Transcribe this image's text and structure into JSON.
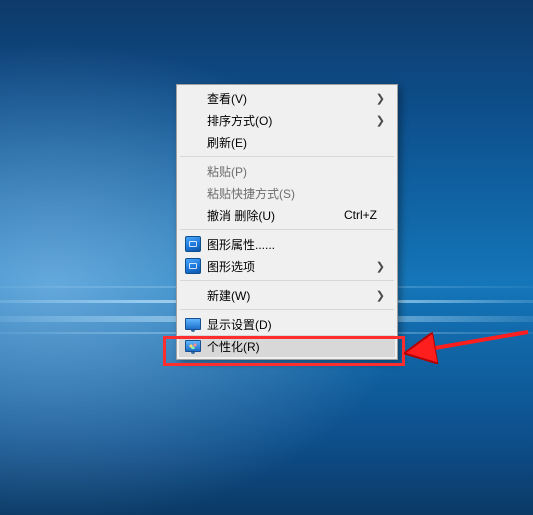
{
  "menu": {
    "view": {
      "label": "查看(V)"
    },
    "sort": {
      "label": "排序方式(O)"
    },
    "refresh": {
      "label": "刷新(E)"
    },
    "paste": {
      "label": "粘贴(P)"
    },
    "paste_sc": {
      "label": "粘贴快捷方式(S)"
    },
    "undo": {
      "label": "撤消 删除(U)",
      "shortcut": "Ctrl+Z"
    },
    "gfx_prop": {
      "label": "图形属性......"
    },
    "gfx_opt": {
      "label": "图形选项"
    },
    "new": {
      "label": "新建(W)"
    },
    "display": {
      "label": "显示设置(D)"
    },
    "personalize": {
      "label": "个性化(R)"
    }
  }
}
